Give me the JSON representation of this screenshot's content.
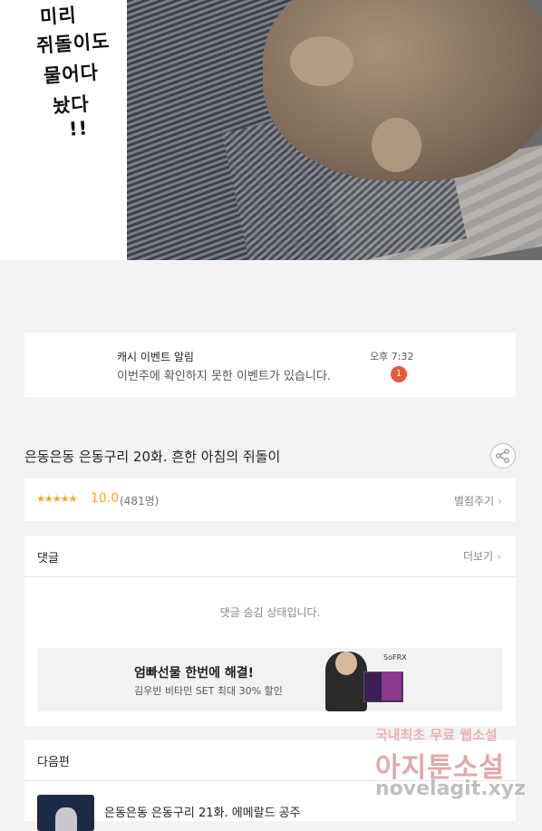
{
  "panel": {
    "handwriting": [
      "미리",
      "쥐돌이도",
      "물어다",
      "놨다",
      "!!"
    ]
  },
  "notification": {
    "title": "캐시 이벤트 알림",
    "message": "이번주에 확인하지 못한 이벤트가 있습니다.",
    "time": "오후 7:32",
    "badge": "1"
  },
  "episode": {
    "title": "은동은동 은동구리 20화. 흔한 아침의 쥐돌이",
    "share_icon": "share-icon"
  },
  "rating": {
    "stars": "★★★★★",
    "score": "10.0",
    "count": "(481명)",
    "rate_label": "별점주기",
    "star_color": "#f5a623"
  },
  "comments": {
    "title": "댓글",
    "more": "더보기",
    "hidden_message": "댓글 숨김 상태입니다."
  },
  "ad": {
    "title": "엄빠선물 한번에 해결!",
    "subtitle": "김우빈 비타민 SET 최대 30% 할인",
    "brand": "SoFRX"
  },
  "next": {
    "title": "다음편",
    "episode_title": "은동은동 은동구리 21화. 에메랄드 공주"
  },
  "watermark": {
    "line1": "국내최초 무료 웹소설",
    "line2": "아지툰소설",
    "line3": "novelagit.xyz"
  },
  "colors": {
    "badge": "#e8563c",
    "background": "#f3f3f3"
  }
}
